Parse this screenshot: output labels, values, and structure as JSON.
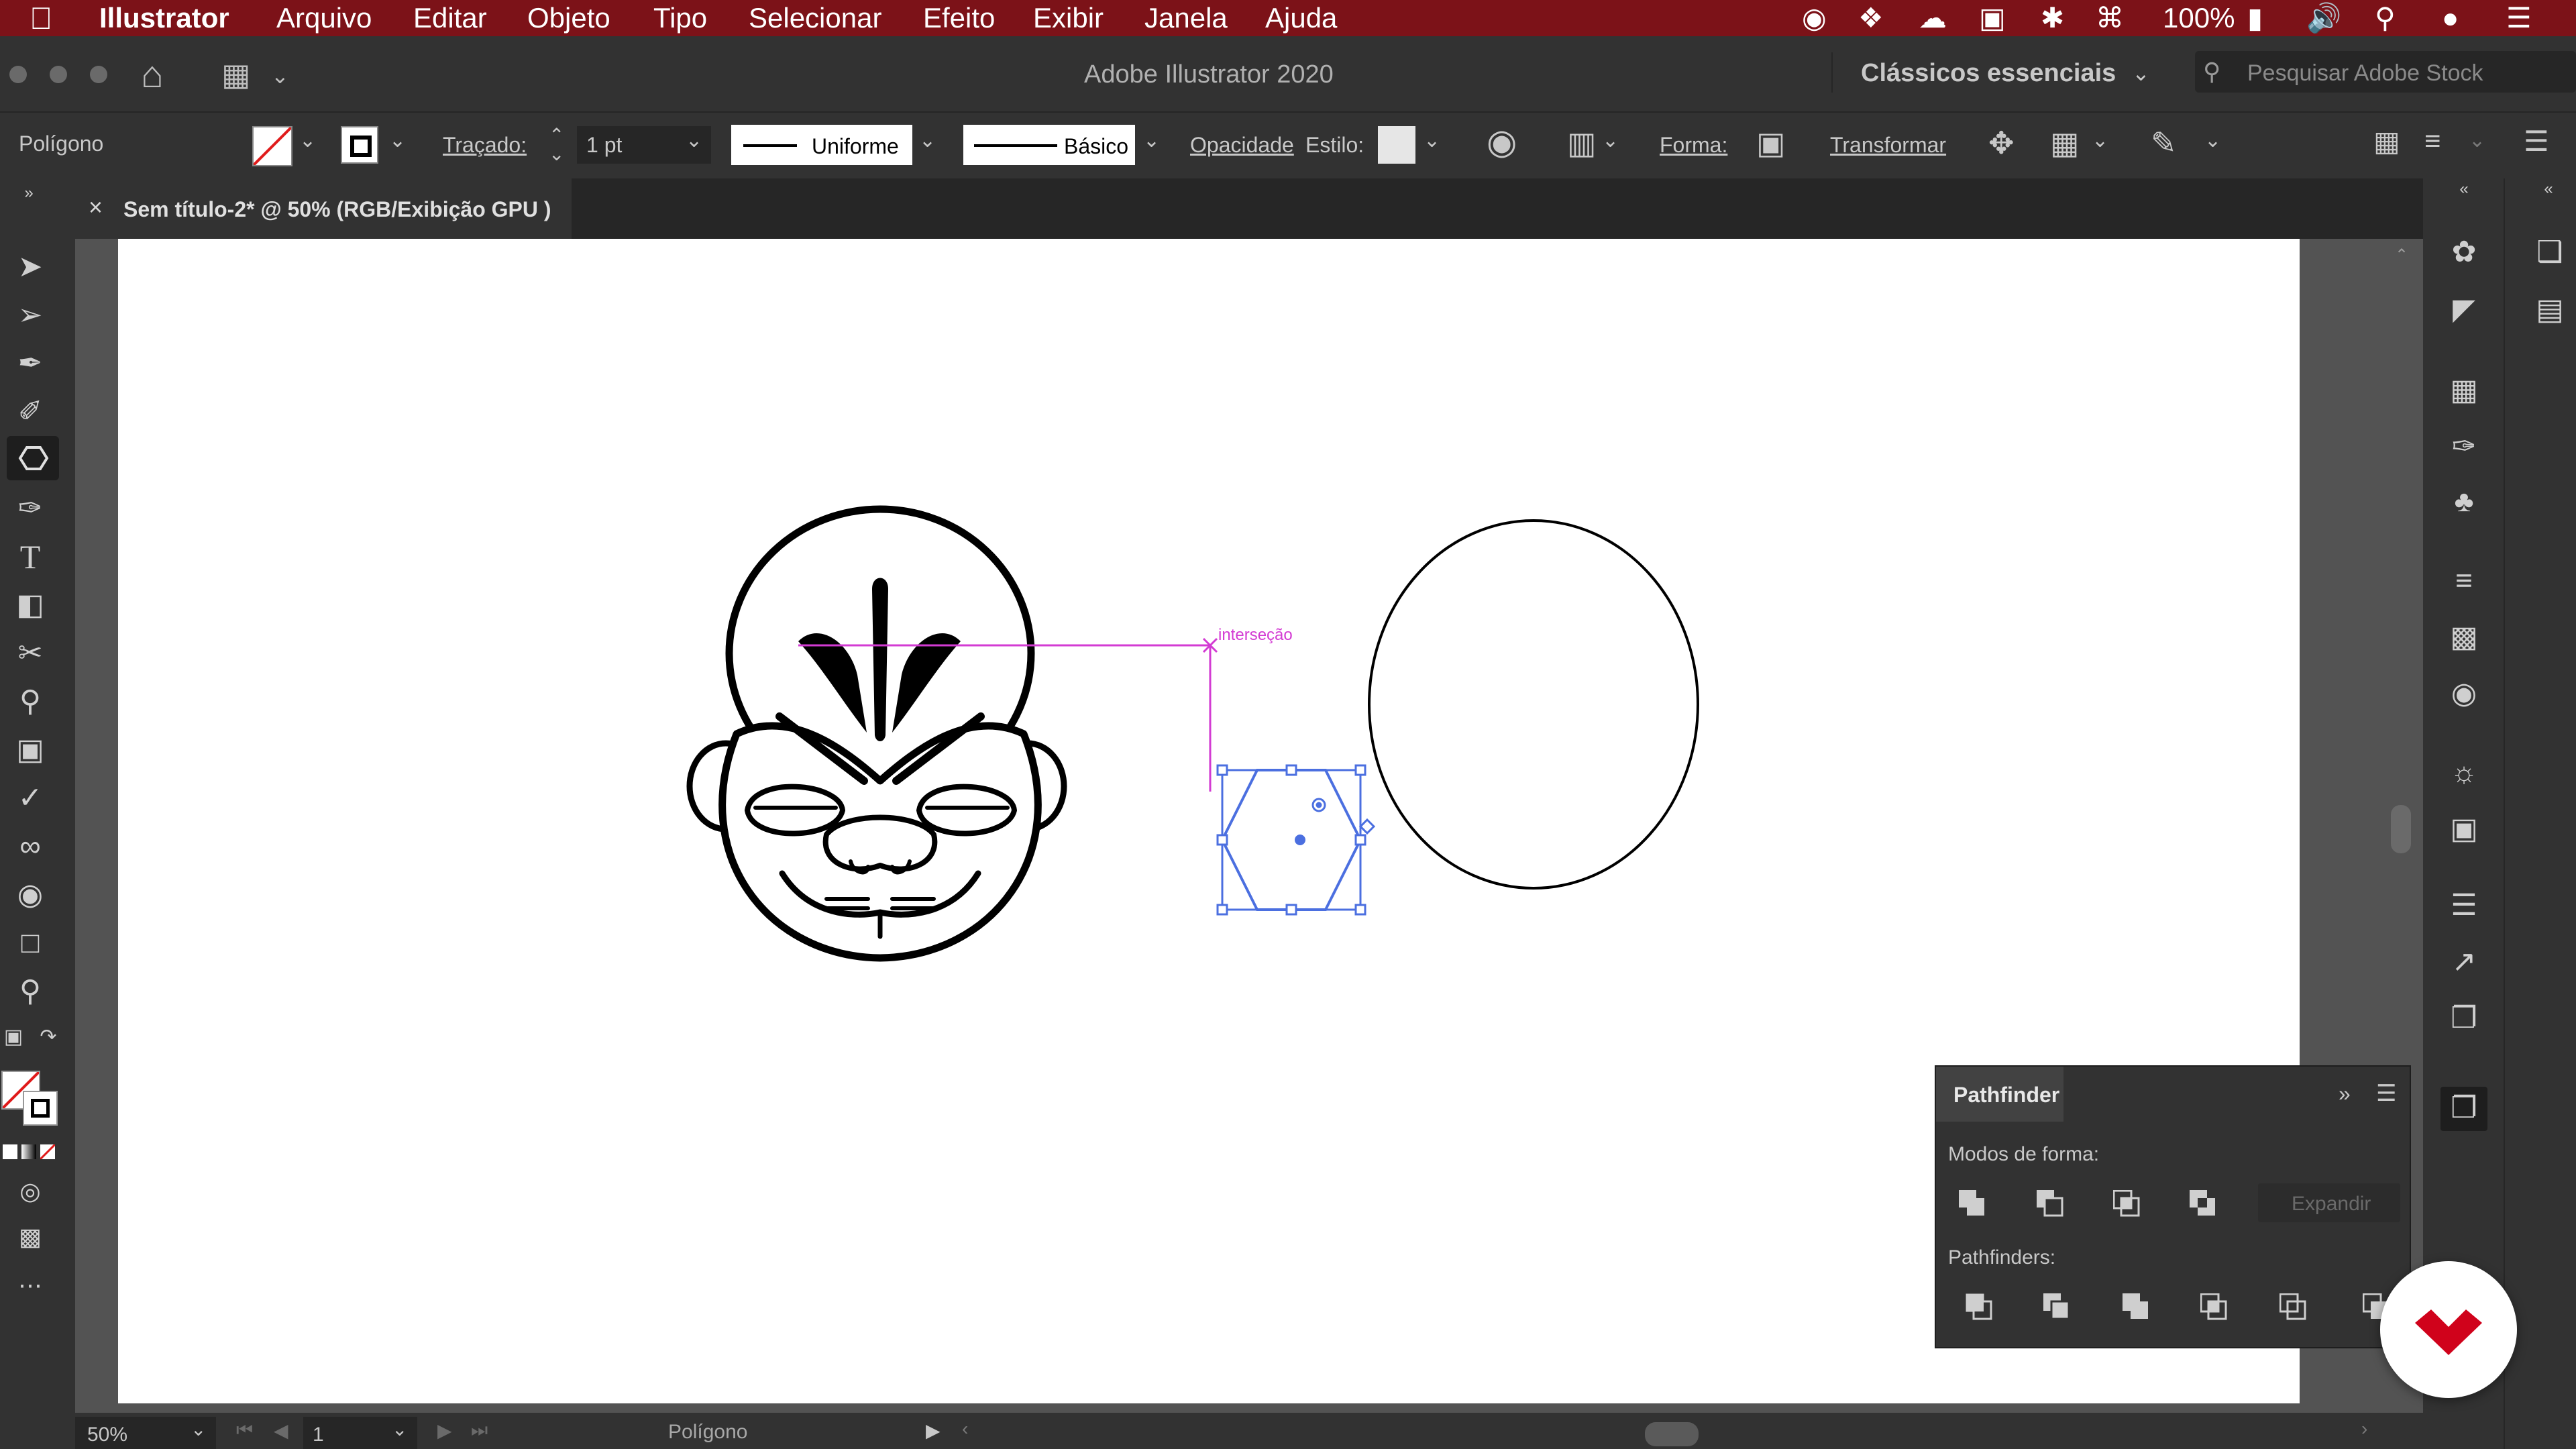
{
  "menubar": {
    "app_name": "Illustrator",
    "items": [
      "Arquivo",
      "Editar",
      "Objeto",
      "Tipo",
      "Selecionar",
      "Efeito",
      "Exibir",
      "Janela",
      "Ajuda"
    ],
    "battery": "100%"
  },
  "titlebar": {
    "title": "Adobe Illustrator 2020",
    "workspace": "Clássicos essenciais",
    "search_placeholder": "Pesquisar Adobe Stock"
  },
  "controlbar": {
    "object_type": "Polígono",
    "stroke_label": "Traçado:",
    "stroke_weight": "1 pt",
    "stroke_profile": "Uniforme",
    "brush": "Básico",
    "opacity_label": "Opacidade",
    "style_label": "Estilo:",
    "shape_label": "Forma:",
    "transform_label": "Transformar"
  },
  "document": {
    "tab_title": "Sem título-2* @ 50% (RGB/Exibição GPU )",
    "smart_guide_label": "interseção"
  },
  "statusbar": {
    "zoom": "50%",
    "artboard_number": "1",
    "tool_name": "Polígono"
  },
  "pathfinder": {
    "title": "Pathfinder",
    "shape_modes_label": "Modos de forma:",
    "expand_label": "Expandir",
    "pathfinders_label": "Pathfinders:"
  },
  "colors": {
    "menubar": "#7c1218",
    "selection": "#4b6fe0",
    "smart_guide": "#d33bd3",
    "badge": "#d0021b"
  }
}
